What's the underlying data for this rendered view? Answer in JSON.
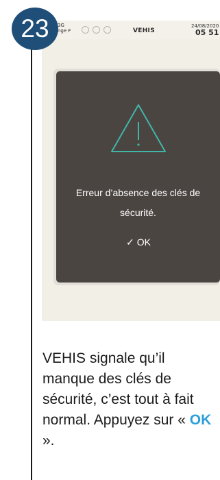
{
  "step_number": "23",
  "status_bar": {
    "network": "3G",
    "carrier": "nge F",
    "app_name": "VEHIS",
    "date": "24/08/2020",
    "time": "05 51"
  },
  "dialog": {
    "message_line1": "Erreur d’absence des clés de",
    "message_line2": "sécurité.",
    "ok_label": "OK",
    "icon": "warning-triangle-icon",
    "check_icon": "checkmark-icon"
  },
  "caption": {
    "text_before": "VEHIS signale qu’il manque des clés de sécurité, c’est tout à fait normal. Appuyez sur « ",
    "highlight": "OK",
    "text_after": " »."
  },
  "colors": {
    "badge": "#1f4e79",
    "dialog_bg": "#4b4542",
    "icon_accent": "#3fb6a8",
    "highlight": "#2e9fd8"
  }
}
